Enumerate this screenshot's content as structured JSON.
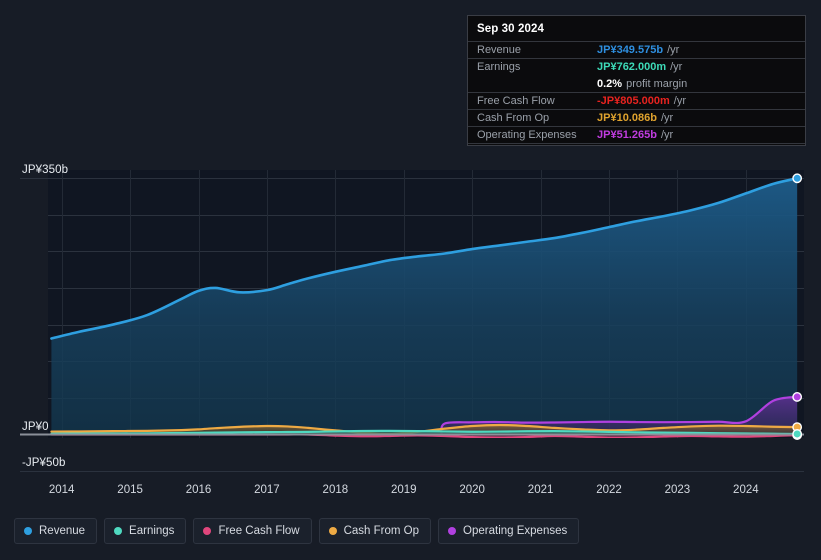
{
  "page": {
    "background": "#171c26",
    "plot_background": "#101622"
  },
  "tooltip": {
    "title": "Sep 30 2024",
    "rows": [
      {
        "label": "Revenue",
        "value": "JP¥349.575b",
        "unit": "/yr",
        "color": "#2e8fe0"
      },
      {
        "label": "Earnings",
        "value": "JP¥762.000m",
        "unit": "/yr",
        "color": "#3ddbb8"
      },
      {
        "label": "",
        "value": "0.2%",
        "unit": "profit margin",
        "color": "#ffffff"
      },
      {
        "label": "Free Cash Flow",
        "value": "-JP¥805.000m",
        "unit": "/yr",
        "color": "#e8231f"
      },
      {
        "label": "Cash From Op",
        "value": "JP¥10.086b",
        "unit": "/yr",
        "color": "#e0a32e"
      },
      {
        "label": "Operating Expenses",
        "value": "JP¥51.265b",
        "unit": "/yr",
        "color": "#c13ce0"
      }
    ]
  },
  "legend": {
    "items": [
      {
        "label": "Revenue",
        "color": "#2e9fe0"
      },
      {
        "label": "Earnings",
        "color": "#4fd9c0"
      },
      {
        "label": "Free Cash Flow",
        "color": "#e0467c"
      },
      {
        "label": "Cash From Op",
        "color": "#eeaa44"
      },
      {
        "label": "Operating Expenses",
        "color": "#b040e0"
      }
    ]
  },
  "chart_data": {
    "type": "area",
    "title": "",
    "xlabel": "",
    "ylabel": "",
    "currency": "JP¥",
    "grid": true,
    "legend_position": "bottom",
    "ylim": [
      -50,
      350
    ],
    "yticks": [
      350,
      0,
      -50
    ],
    "ytick_labels": [
      "JP¥350b",
      "JP¥0",
      "-JP¥50b"
    ],
    "gridline_values": [
      350,
      300,
      250,
      200,
      150,
      100,
      50,
      0,
      -50
    ],
    "xlim": [
      2013.8,
      2024.85
    ],
    "xticks": [
      2014,
      2015,
      2016,
      2017,
      2018,
      2019,
      2020,
      2021,
      2022,
      2023,
      2024
    ],
    "xtick_labels": [
      "2014",
      "2015",
      "2016",
      "2017",
      "2018",
      "2019",
      "2020",
      "2021",
      "2022",
      "2023",
      "2024"
    ],
    "x": [
      2013.85,
      2014.25,
      2014.75,
      2015.25,
      2015.75,
      2016.0,
      2016.25,
      2016.6,
      2017.0,
      2017.3,
      2017.6,
      2018.0,
      2018.4,
      2018.8,
      2019.2,
      2019.6,
      2020.0,
      2020.4,
      2020.8,
      2021.2,
      2021.6,
      2022.0,
      2022.4,
      2022.8,
      2023.2,
      2023.6,
      2024.0,
      2024.4,
      2024.75
    ],
    "series": [
      {
        "name": "Revenue",
        "color": "#2e9fe0",
        "fill": true,
        "end_value": 349.575,
        "values": [
          131,
          140,
          150,
          163,
          185,
          196,
          200,
          194,
          197,
          205,
          213,
          222,
          230,
          238,
          243,
          247,
          253,
          258,
          263,
          268,
          275,
          283,
          291,
          298,
          306,
          316,
          329,
          342,
          349.575
        ]
      },
      {
        "name": "Earnings",
        "color": "#4fd9c0",
        "fill": true,
        "end_value": 0.762,
        "values": [
          1.0,
          1.2,
          1.4,
          1.6,
          2.0,
          2.3,
          2.6,
          3.0,
          3.2,
          3.4,
          3.6,
          4.2,
          4.8,
          5.0,
          4.6,
          4.2,
          3.8,
          4.0,
          4.4,
          4.6,
          4.2,
          3.6,
          3.0,
          2.6,
          2.2,
          1.8,
          1.4,
          1.0,
          0.762
        ]
      },
      {
        "name": "Free Cash Flow",
        "color": "#e0467c",
        "fill": true,
        "end_value": -0.805,
        "values": [
          0,
          0,
          0,
          0,
          0,
          0,
          0,
          0,
          0,
          0,
          0,
          -1.5,
          -2.4,
          -2.0,
          -1.2,
          -2.0,
          -3.6,
          -4.2,
          -3.4,
          -2.0,
          -3.0,
          -4.4,
          -4.0,
          -2.8,
          -2.0,
          -2.6,
          -3.0,
          -2.0,
          -0.805
        ]
      },
      {
        "name": "Cash From Op",
        "color": "#eeaa44",
        "fill": true,
        "end_value": 10.086,
        "values": [
          4.0,
          4.2,
          4.6,
          5.0,
          6.0,
          7.0,
          8.6,
          10.4,
          11.6,
          11.0,
          9.0,
          5.6,
          2.4,
          1.0,
          3.6,
          8.0,
          11.6,
          13.0,
          11.6,
          9.0,
          7.0,
          5.6,
          6.6,
          9.0,
          11.0,
          12.0,
          11.6,
          10.6,
          10.086
        ]
      },
      {
        "name": "Operating Expenses",
        "color": "#b040e0",
        "fill": true,
        "start_x": 2019.55,
        "end_value": 51.265,
        "values": [
          null,
          null,
          null,
          null,
          null,
          null,
          null,
          null,
          null,
          null,
          null,
          null,
          null,
          null,
          null,
          15.0,
          16.6,
          17.0,
          16.2,
          16.4,
          17.0,
          17.4,
          17.0,
          16.8,
          17.0,
          17.4,
          18.0,
          46.0,
          51.265
        ]
      }
    ]
  }
}
